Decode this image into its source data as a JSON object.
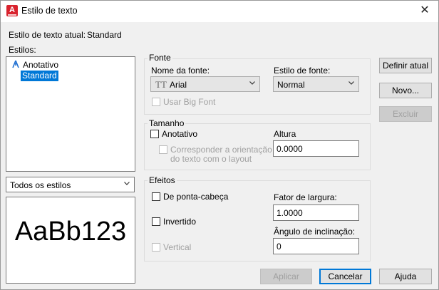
{
  "window": {
    "title": "Estilo de texto",
    "close_glyph": "✕"
  },
  "current_style": {
    "label": "Estilo de texto atual:",
    "value": "Standard"
  },
  "styles": {
    "label": "Estilos:",
    "items": [
      {
        "label": "Anotativo",
        "icon": "annotative-icon"
      },
      {
        "label": "Standard",
        "selected": true
      }
    ],
    "filter_value": "Todos os estilos"
  },
  "preview_text": "AaBb123",
  "font_group": {
    "title": "Fonte",
    "font_name_label": "Nome da fonte:",
    "font_name_value": "Arial",
    "font_style_label": "Estilo de fonte:",
    "font_style_value": "Normal",
    "big_font_label": "Usar Big Font"
  },
  "size_group": {
    "title": "Tamanho",
    "annotative_label": "Anotativo",
    "match_label_line1": "Corresponder a orientação",
    "match_label_line2": "do texto com o layout",
    "height_label": "Altura",
    "height_value": "0.0000"
  },
  "effects_group": {
    "title": "Efeitos",
    "upside_down_label": "De ponta-cabeça",
    "backwards_label": "Invertido",
    "vertical_label": "Vertical",
    "width_factor_label": "Fator de largura:",
    "width_factor_value": "1.0000",
    "oblique_label": "Ângulo de inclinação:",
    "oblique_value": "0"
  },
  "buttons": {
    "set_current": "Definir atual",
    "new": "Novo...",
    "delete": "Excluir",
    "apply": "Aplicar",
    "cancel": "Cancelar",
    "help": "Ajuda"
  },
  "colors": {
    "selection": "#0078d7",
    "accent_icon": "#d9232e"
  }
}
